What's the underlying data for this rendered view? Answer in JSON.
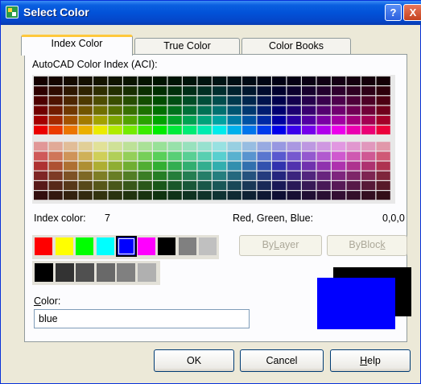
{
  "window": {
    "title": "Select Color"
  },
  "titlebar_buttons": {
    "help": "?",
    "close": "X"
  },
  "tabs": [
    {
      "label": "Index Color",
      "active": true
    },
    {
      "label": "True Color",
      "active": false
    },
    {
      "label": "Color Books",
      "active": false
    }
  ],
  "aci_label": "AutoCAD Color Index (ACI):",
  "index_color": {
    "label": "Index color:",
    "value": "7"
  },
  "rgb": {
    "label": "Red, Green, Blue:",
    "value": "0,0,0"
  },
  "standard_colors": [
    "#ff0000",
    "#ffff00",
    "#00ff00",
    "#00ffff",
    "#0000ff",
    "#ff00ff",
    "#000000",
    "#808080",
    "#c0c0c0"
  ],
  "selected_swatch_index": 4,
  "gray_colors": [
    "#000000",
    "#333333",
    "#505050",
    "#696969",
    "#808080",
    "#b0b0b0"
  ],
  "bylayer": {
    "prefix": "By",
    "ul": "L",
    "suffix": "ayer"
  },
  "byblock": {
    "prefix": "ByBloc",
    "ul": "k",
    "suffix": ""
  },
  "color_field": {
    "label_ul": "C",
    "label_rest": "olor:",
    "value": "blue"
  },
  "preview": {
    "old": "#000000",
    "new": "#0000ff"
  },
  "buttons": {
    "ok": "OK",
    "cancel": "Cancel",
    "help_ul": "H",
    "help_rest": "elp"
  }
}
